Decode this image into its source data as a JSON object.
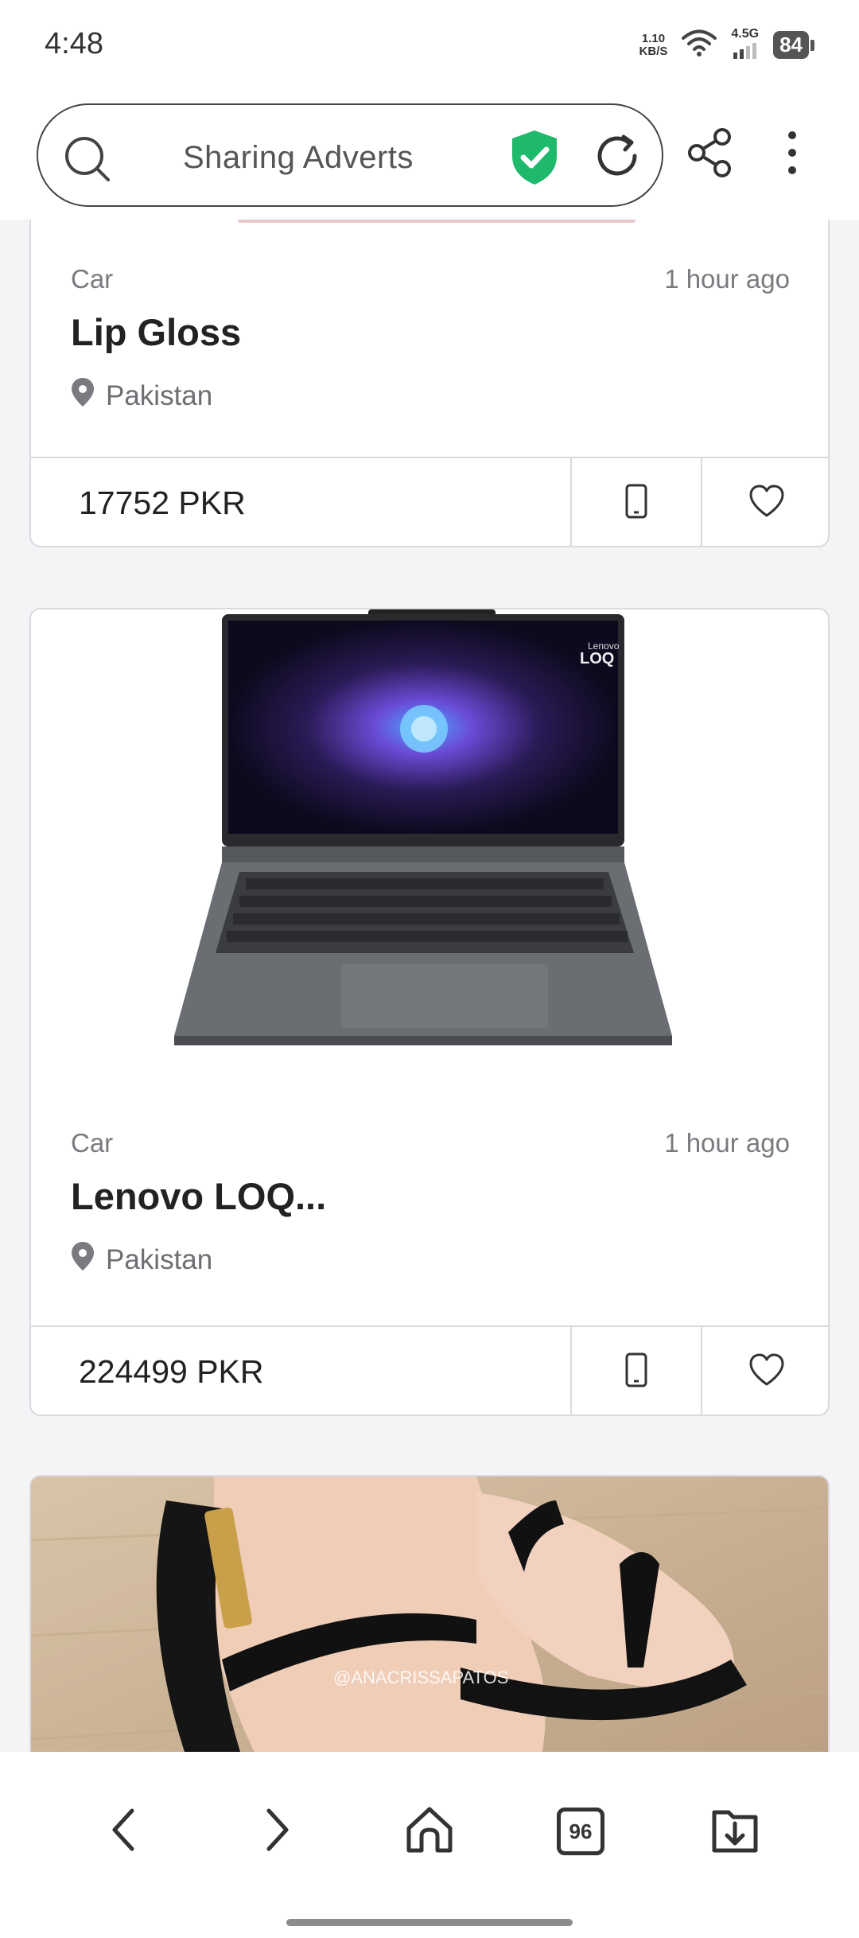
{
  "status_bar": {
    "time": "4:48",
    "speed_value": "1.10",
    "speed_unit": "KB/S",
    "network_type": "4.5G",
    "battery": "84"
  },
  "browser": {
    "url_text": "Sharing Adverts",
    "icons": [
      "search-icon",
      "shield-check-icon",
      "reload-icon",
      "share-icon",
      "more-vertical-icon"
    ]
  },
  "listings": [
    {
      "category": "Car",
      "time_ago": "1 hour ago",
      "title": "Lip Gloss",
      "location": "Pakistan",
      "price": "17752 PKR"
    },
    {
      "category": "Car",
      "time_ago": "1 hour ago",
      "title": "Lenovo LOQ...",
      "location": "Pakistan",
      "price": "224499 PKR",
      "image_brand": "Lenovo",
      "image_logo": "LOQ"
    },
    {
      "image_watermark": "@ANACRISSAPATOS"
    }
  ],
  "bottom_nav": {
    "tabs_count": "96",
    "icons": [
      "back-icon",
      "forward-icon",
      "home-icon",
      "tabs-icon",
      "downloads-icon"
    ]
  },
  "colors": {
    "shield": "#1fb96b",
    "border": "#d9d9de",
    "muted_text": "#7a7a80"
  }
}
